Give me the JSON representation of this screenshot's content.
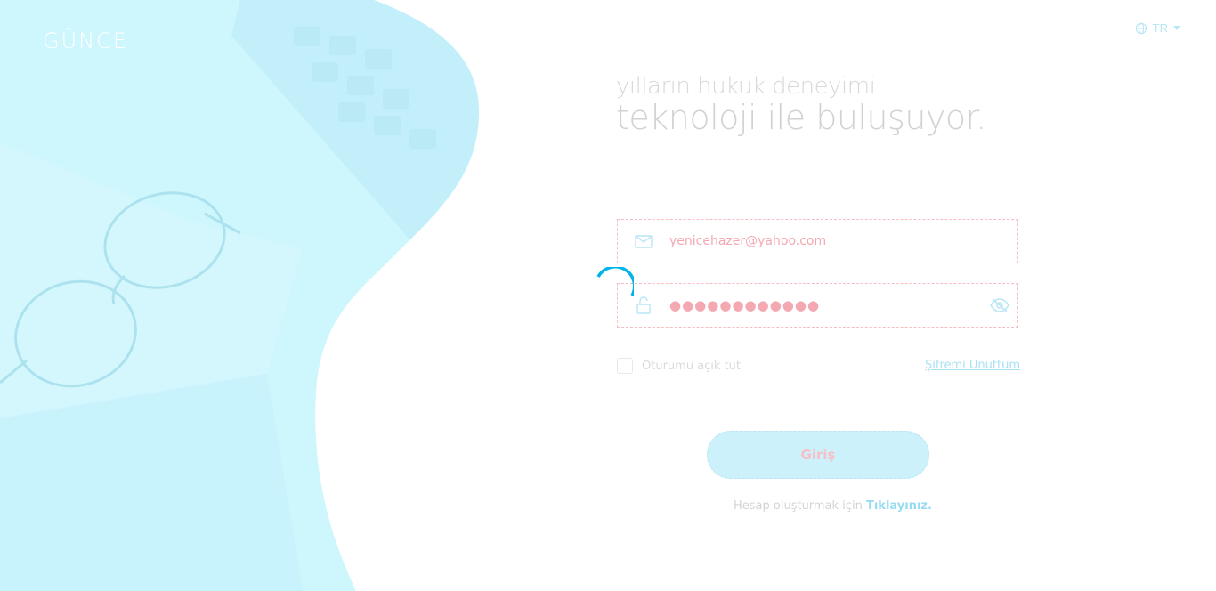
{
  "brand": {
    "logo_text": "GÜNCE"
  },
  "language": {
    "selected": "TR"
  },
  "headline": {
    "line1": "yılların hukuk deneyimi",
    "line2": "teknoloji ile buluşuyor."
  },
  "form": {
    "email_value": "yenicehazer@yahoo.com",
    "password_masked": "●●●●●●●●●●●●",
    "remember_label": "Oturumu açık tut",
    "forgot_label": "Şifremi Unuttum",
    "submit_label": "Giriş",
    "register_text": "Hesap oluşturmak için",
    "register_link": "Tıklayınız."
  },
  "colors": {
    "accent": "#00b4e6",
    "panel": "#c9f3fd",
    "field_border": "#f5bcc2",
    "field_text": "#f3a8b2"
  },
  "icons": {
    "globe": "globe-icon",
    "email": "envelope-icon",
    "password": "lock-icon",
    "toggle_visibility": "eye-slash-icon",
    "loading": "spinner-icon"
  }
}
